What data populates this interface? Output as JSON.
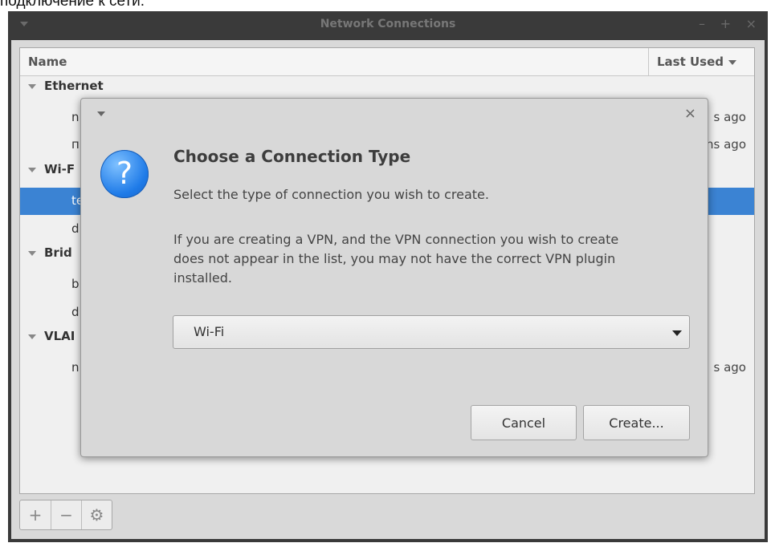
{
  "caption": "подключение к сети.",
  "window": {
    "title": "Network Connections",
    "controls": [
      "–",
      "+",
      "×"
    ]
  },
  "list": {
    "col_name": "Name",
    "col_last_used": "Last Used",
    "rows": [
      {
        "kind": "group",
        "label": "Ethernet"
      },
      {
        "kind": "item",
        "label": "n",
        "time": "s ago"
      },
      {
        "kind": "item",
        "label": "п",
        "time": "ns ago"
      },
      {
        "kind": "group",
        "label": "Wi-F"
      },
      {
        "kind": "item",
        "label": "te",
        "time": "",
        "selected": true
      },
      {
        "kind": "item",
        "label": "d",
        "time": ""
      },
      {
        "kind": "group",
        "label": "Brid"
      },
      {
        "kind": "item",
        "label": "b",
        "time": ""
      },
      {
        "kind": "item",
        "label": "d",
        "time": ""
      },
      {
        "kind": "group",
        "label": "VLAI"
      },
      {
        "kind": "item",
        "label": "n",
        "time": "s ago"
      }
    ]
  },
  "toolbar": {
    "add": "+",
    "remove": "−",
    "settings": "⚙"
  },
  "dialog": {
    "close": "×",
    "title": "Choose a Connection Type",
    "subtitle": "Select the type of connection you wish to create.",
    "info_lines": [
      "If you are creating a VPN, and the VPN connection you wish to create",
      "does not appear in the list, you may not have the correct VPN plugin",
      "installed."
    ],
    "combo_value": "Wi-Fi",
    "cancel": "Cancel",
    "create": "Create..."
  },
  "colors": {
    "selection": "#3b83d3",
    "icon": "#1f7be8"
  }
}
